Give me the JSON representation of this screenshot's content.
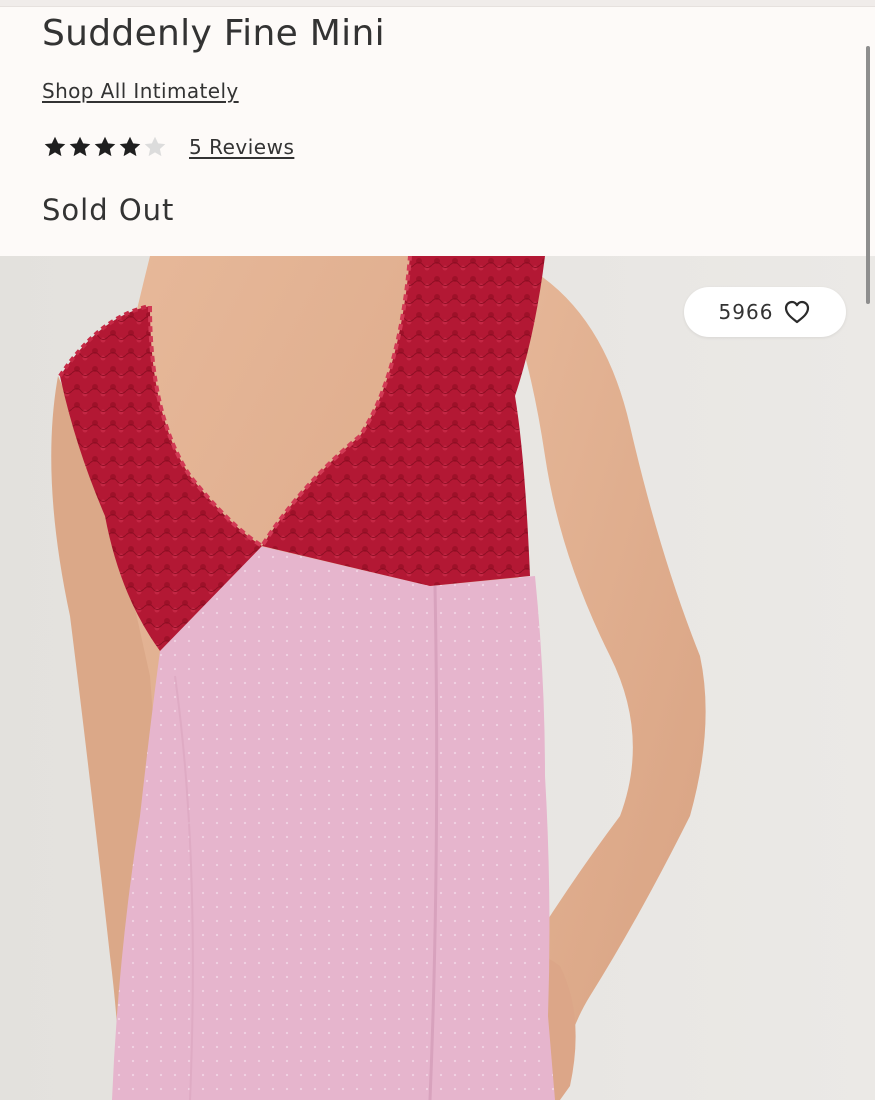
{
  "product": {
    "title": "Suddenly Fine Mini",
    "collection_link": "Shop All Intimately",
    "rating": {
      "stars": 4,
      "out_of": 5,
      "reviews_label": "5 Reviews"
    },
    "availability": "Sold Out"
  },
  "favorites": {
    "count": "5966",
    "icon": "heart-outline-icon"
  },
  "image": {
    "subject": "product photo of model wearing slip mini dress"
  },
  "colors": {
    "header_bg": "#fdfaf8",
    "text": "#333333",
    "star_filled": "#1f1f1f",
    "star_empty": "#dcdcdc",
    "photo_bg": "#e8e6e3",
    "lace_red": "#b51a34",
    "dress_pink": "#e7b7cf"
  }
}
